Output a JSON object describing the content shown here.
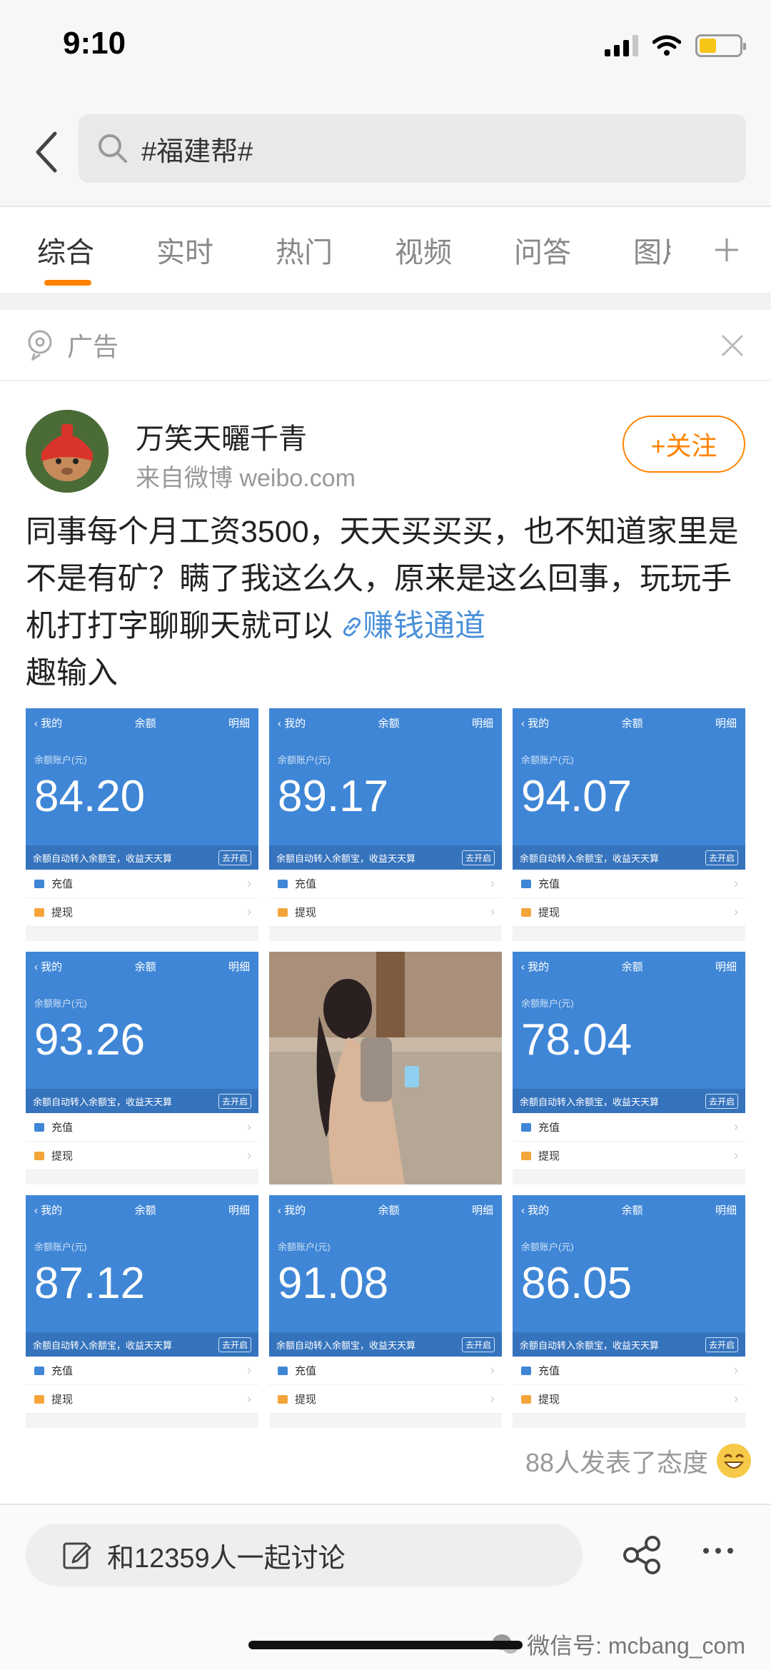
{
  "status_bar": {
    "time": "9:10"
  },
  "search": {
    "query": "#福建帮#"
  },
  "tabs": [
    {
      "label": "综合"
    },
    {
      "label": "实时"
    },
    {
      "label": "热门"
    },
    {
      "label": "视频"
    },
    {
      "label": "问答"
    },
    {
      "label": "图片"
    }
  ],
  "ad": {
    "label": "广告"
  },
  "post": {
    "username": "万笑天曬千青",
    "source": "来自微博 weibo.com",
    "follow_label": "+关注",
    "text": "同事每个月工资3500，天天买买买，也不知道家里是不是有矿？瞒了我这么久，原来是这么回事，玩玩手机打打字聊聊天就可以",
    "link_text": "赚钱通道",
    "text_tail": "趣输入"
  },
  "balance_screen": {
    "back_label": "我的",
    "title": "余额",
    "detail_label": "明细",
    "account_label": "余额账户(元)",
    "auto_transfer_note": "余额自动转入余额宝，收益天天算",
    "enable_label": "去开启",
    "recharge_label": "充值",
    "withdraw_label": "提现"
  },
  "grid_amounts": [
    "84.20",
    "89.17",
    "94.07",
    "93.26",
    "",
    "78.04",
    "87.12",
    "91.08",
    "86.05"
  ],
  "reactions": {
    "text": "88人发表了态度"
  },
  "bottom": {
    "discuss_text": "和12359人一起讨论",
    "watermark": "微信号: mcbang_com"
  }
}
